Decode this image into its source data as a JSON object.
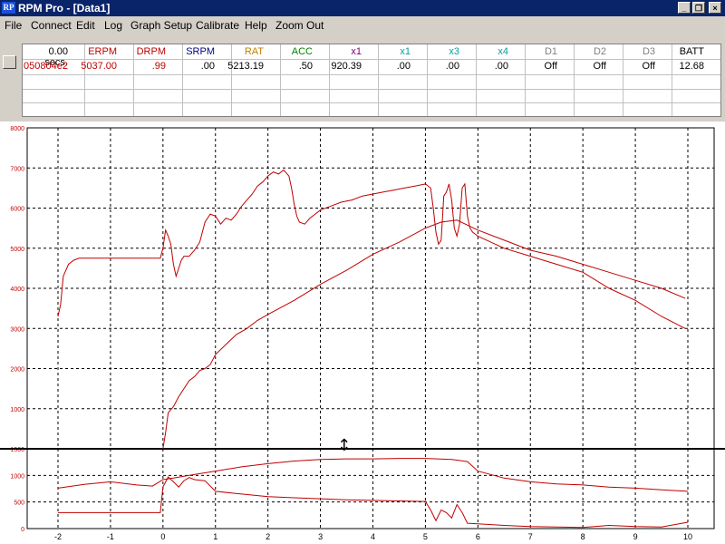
{
  "window": {
    "app_icon": "RP",
    "title": "RPM Pro - [Data1]",
    "buttons": [
      "_",
      "❐",
      "×"
    ]
  },
  "menu": [
    "File",
    "Connect",
    "Edit",
    "Log",
    "Graph Setup",
    "Calibrate",
    "Help",
    "Zoom Out"
  ],
  "table": {
    "headers": [
      {
        "text": "0.00 secs.",
        "color": "#000000"
      },
      {
        "text": "ERPM",
        "color": "#c00000"
      },
      {
        "text": "DRPM",
        "color": "#c00000"
      },
      {
        "text": "SRPM",
        "color": "#000080"
      },
      {
        "text": "RAT",
        "color": "#c08000"
      },
      {
        "text": "ACC",
        "color": "#008000"
      },
      {
        "text": "x1",
        "color": "#800080"
      },
      {
        "text": "x1",
        "color": "#00a0a0"
      },
      {
        "text": "x3",
        "color": "#00a0a0"
      },
      {
        "text": "x4",
        "color": "#00a0a0"
      },
      {
        "text": "D1",
        "color": "#808080"
      },
      {
        "text": "D2",
        "color": "#808080"
      },
      {
        "text": "D3",
        "color": "#808080"
      },
      {
        "text": "BATT",
        "color": "#000000"
      }
    ],
    "values": [
      "050804e2",
      "5037.00",
      ".99",
      ".00",
      "5213.19",
      ".50",
      "920.39",
      ".00",
      ".00",
      ".00",
      "Off",
      "Off",
      "Off",
      "12.68"
    ]
  },
  "chart_data": {
    "type": "line",
    "x_ticks": [
      "-2",
      "-1",
      "0",
      "1",
      "2",
      "3",
      "4",
      "5",
      "6",
      "7",
      "8",
      "9",
      "10"
    ],
    "upper_y_ticks": [
      "8000",
      "7000",
      "6000",
      "5000",
      "4000",
      "3000",
      "2000",
      "1000"
    ],
    "lower_y_ticks": [
      "1500",
      "1000",
      "500",
      "0"
    ],
    "upper_ylim": [
      0,
      8000
    ],
    "lower_ylim": [
      0,
      1500
    ],
    "xlim": [
      -2,
      10
    ],
    "grid": true,
    "series_color": "#c00000",
    "upper_series": [
      {
        "x": [
          -2,
          -1.95,
          -1.9,
          -1.8,
          -1.7,
          -1.6,
          -1.5,
          -1,
          -0.5,
          -0.05,
          0,
          0.05,
          0.1,
          0.15,
          0.2,
          0.25,
          0.3,
          0.35,
          0.4,
          0.5,
          0.6,
          0.7,
          0.8,
          0.9,
          1,
          1.1,
          1.2,
          1.3,
          1.4,
          1.5,
          1.6,
          1.7,
          1.8,
          1.9,
          2,
          2.1,
          2.2,
          2.3,
          2.4,
          2.45,
          2.5,
          2.55,
          2.6,
          2.7,
          2.8,
          2.9,
          3,
          3.2,
          3.4,
          3.6,
          3.8,
          4,
          4.2,
          4.4,
          4.6,
          4.8,
          5,
          5.1,
          5.15,
          5.2,
          5.25,
          5.3,
          5.35,
          5.4,
          5.45,
          5.5,
          5.55,
          5.6,
          5.65,
          5.7,
          5.75,
          5.8,
          5.85,
          5.9,
          6,
          6.5,
          7,
          7.5,
          8,
          8.5,
          9,
          9.5,
          9.95
        ],
        "y": [
          3300,
          3600,
          4300,
          4600,
          4700,
          4750,
          4750,
          4750,
          4750,
          4750,
          5000,
          5450,
          5300,
          5100,
          4600,
          4300,
          4500,
          4700,
          4800,
          4800,
          4950,
          5150,
          5650,
          5850,
          5800,
          5600,
          5750,
          5700,
          5850,
          6050,
          6200,
          6350,
          6550,
          6650,
          6800,
          6900,
          6850,
          6950,
          6800,
          6500,
          6100,
          5800,
          5650,
          5600,
          5750,
          5850,
          5950,
          6050,
          6150,
          6200,
          6300,
          6350,
          6400,
          6450,
          6500,
          6550,
          6600,
          6500,
          6000,
          5400,
          5100,
          5200,
          6300,
          6400,
          6600,
          6200,
          5500,
          5300,
          5600,
          6500,
          6600,
          5800,
          5500,
          5400,
          5300,
          5000,
          4800,
          4600,
          4400,
          4000,
          3700,
          3300,
          3000
        ]
      },
      {
        "x": [
          0,
          0.05,
          0.1,
          0.2,
          0.3,
          0.4,
          0.5,
          0.6,
          0.7,
          0.8,
          0.9,
          1,
          1.2,
          1.4,
          1.6,
          1.8,
          2,
          2.5,
          3,
          3.5,
          4,
          4.5,
          5,
          5.3,
          5.6,
          6,
          6.5,
          7,
          7.5,
          8,
          8.5,
          9,
          9.5,
          9.95
        ],
        "y": [
          0,
          400,
          900,
          1050,
          1300,
          1500,
          1700,
          1800,
          1950,
          2000,
          2100,
          2350,
          2600,
          2850,
          3000,
          3200,
          3350,
          3700,
          4100,
          4450,
          4850,
          5150,
          5500,
          5650,
          5700,
          5450,
          5200,
          4950,
          4800,
          4600,
          4400,
          4200,
          4000,
          3750
        ]
      }
    ],
    "lower_series": [
      {
        "x": [
          -2,
          -1.5,
          -1,
          -0.5,
          -0.2,
          0,
          0.2,
          0.5,
          1,
          1.5,
          2,
          2.5,
          3,
          3.5,
          4,
          4.5,
          5,
          5.5,
          5.8,
          6,
          6.5,
          7,
          7.5,
          8,
          8.5,
          9,
          9.5,
          10
        ],
        "y": [
          760,
          830,
          880,
          820,
          800,
          920,
          950,
          1000,
          1080,
          1160,
          1220,
          1270,
          1300,
          1310,
          1310,
          1320,
          1320,
          1300,
          1260,
          1080,
          950,
          880,
          840,
          820,
          780,
          760,
          730,
          700
        ]
      },
      {
        "x": [
          -2,
          -1.5,
          -1,
          -0.5,
          -0.05,
          0,
          0.1,
          0.2,
          0.3,
          0.4,
          0.5,
          0.6,
          0.8,
          1,
          1.5,
          2,
          2.5,
          3,
          3.5,
          4,
          4.5,
          5,
          5.1,
          5.2,
          5.3,
          5.4,
          5.5,
          5.6,
          5.7,
          5.8,
          6,
          6.5,
          7,
          7.5,
          8,
          8.5,
          9,
          9.5,
          10
        ],
        "y": [
          300,
          300,
          300,
          300,
          300,
          780,
          970,
          880,
          780,
          900,
          960,
          920,
          900,
          700,
          650,
          600,
          580,
          560,
          540,
          530,
          520,
          510,
          350,
          150,
          350,
          300,
          200,
          450,
          300,
          100,
          90,
          60,
          40,
          30,
          20,
          60,
          40,
          30,
          120
        ]
      }
    ],
    "cursor": {
      "x": 3.45,
      "label": "↕"
    }
  }
}
